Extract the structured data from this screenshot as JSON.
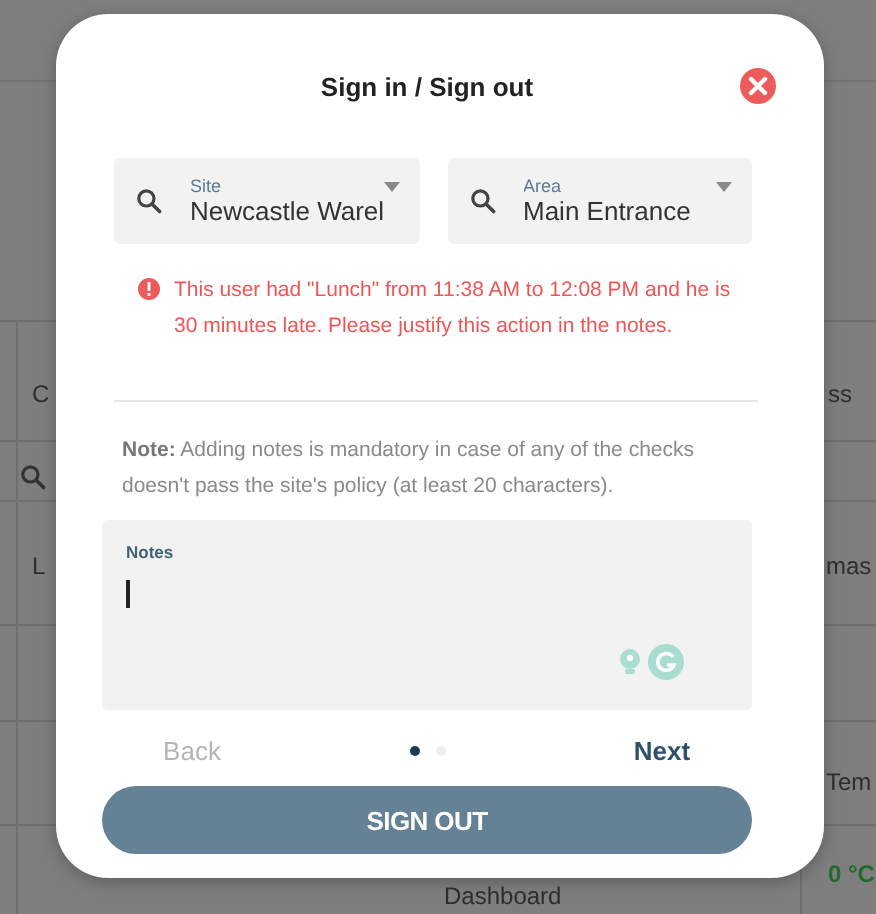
{
  "background": {
    "cells": [
      {
        "kind": "text",
        "text": "C"
      },
      {
        "kind": "text",
        "text": "ss"
      },
      {
        "kind": "search"
      },
      {
        "kind": "text",
        "text": "L"
      },
      {
        "kind": "text",
        "text": "mas"
      },
      {
        "kind": "text",
        "text": "Tem"
      },
      {
        "kind": "text",
        "text": "Dashboard"
      },
      {
        "kind": "value",
        "text": "0 °C"
      }
    ]
  },
  "dialog": {
    "title": "Sign in / Sign out",
    "fields": [
      {
        "label": "Site",
        "value": "Newcastle Warel"
      },
      {
        "label": "Area",
        "value": "Main Entrance"
      }
    ],
    "warning": "This user had \"Lunch\" from 11:38 AM to 12:08 PM and he is 30 minutes late. Please justify this action in the notes.",
    "note": "**Note:** Adding notes is mandatory in case of any of the checks doesn't pass the site's policy (at least 20 characters).",
    "notes_field": {
      "label": "Notes",
      "focused": true
    },
    "back": {
      "label": "Back",
      "disabled": true
    },
    "steps": [
      {
        "selected": true
      },
      {
        "selected": false
      }
    ],
    "next": {
      "label": "Next",
      "disabled": false
    },
    "submit": "SIGN OUT"
  }
}
